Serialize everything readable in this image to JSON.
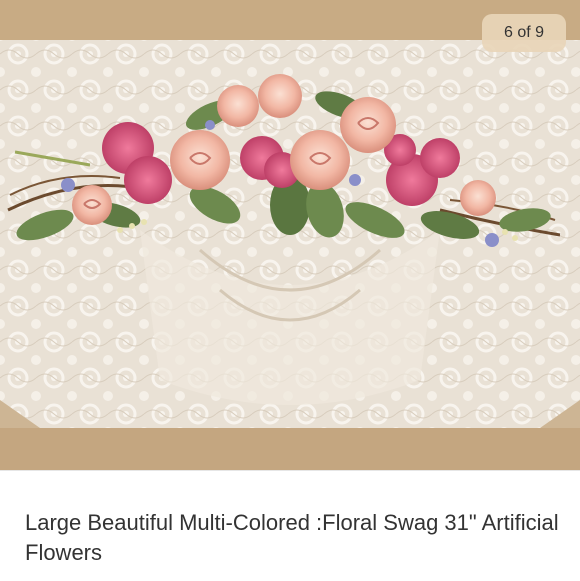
{
  "gallery": {
    "counter": "6 of 9",
    "image_alt": "Floral swag on lace tablecloth"
  },
  "listing": {
    "title": "Large Beautiful Multi-Colored :Floral Swag 31\" Artificial Flowers"
  },
  "colors": {
    "photo_backdrop": "#cdb594",
    "lace": "#ede6dc",
    "rose_peach": "#f2b7a4",
    "hydrangea_pink": "#d9507a",
    "leaf_green": "#6d8a4e"
  }
}
